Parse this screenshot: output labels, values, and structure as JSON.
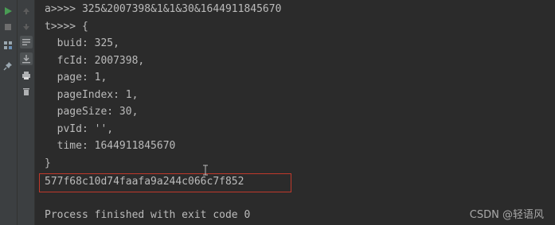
{
  "console": {
    "lines": [
      "a>>>> 325&2007398&1&1&30&1644911845670",
      "t>>>> {",
      "  buid: 325,",
      "  fcId: 2007398,",
      "  page: 1,",
      "  pageIndex: 1,",
      "  pageSize: 30,",
      "  pvId: '',",
      "  time: 1644911845670",
      "}",
      "577f68c10d74faafa9a244c066c7f852",
      "",
      "Process finished with exit code 0"
    ]
  },
  "toolbar": {
    "icons": [
      "run-icon",
      "stop-icon",
      "layout-icon",
      "pin-icon",
      "up-arrow-icon",
      "down-arrow-icon",
      "soft-wrap-icon",
      "scroll-to-end-icon",
      "print-icon",
      "trash-icon"
    ]
  },
  "watermark": {
    "text": "CSDN @轻语风"
  },
  "colors": {
    "background": "#2b2b2b",
    "text": "#bbbbbb",
    "highlight_border": "#c0392b",
    "run_green": "#499c54"
  }
}
